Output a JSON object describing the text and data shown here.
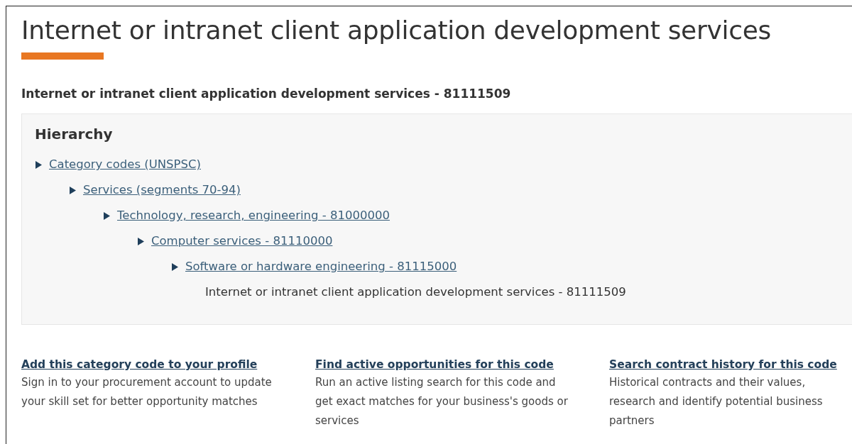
{
  "title": "Internet or intranet client application development services",
  "subtitle": "Internet or intranet client application development services - 81111509",
  "hierarchy": {
    "heading": "Hierarchy",
    "tree": [
      {
        "label": "Category codes (UNSPSC)",
        "kind": "link",
        "children": [
          {
            "label": "Services (segments 70-94)",
            "kind": "link",
            "children": [
              {
                "label": "Technology, research, engineering - 81000000",
                "kind": "link",
                "children": [
                  {
                    "label": "Computer services - 81110000",
                    "kind": "link",
                    "children": [
                      {
                        "label": "Software or hardware engineering - 81115000",
                        "kind": "link",
                        "children": [
                          {
                            "label": "Internet or intranet client application development services - 81111509",
                            "kind": "text"
                          }
                        ]
                      }
                    ]
                  }
                ]
              }
            ]
          }
        ]
      }
    ]
  },
  "actions": [
    {
      "link": "Add this category code to your profile",
      "description": "Sign in to your procurement account to update your skill set for better opportunity matches"
    },
    {
      "link": "Find active opportunities for this code",
      "description": "Run an active listing search for this code and get exact matches for your business's goods or services"
    },
    {
      "link": "Search contract history for this code",
      "description": "Historical contracts and their values, research and identify potential business partners"
    }
  ]
}
